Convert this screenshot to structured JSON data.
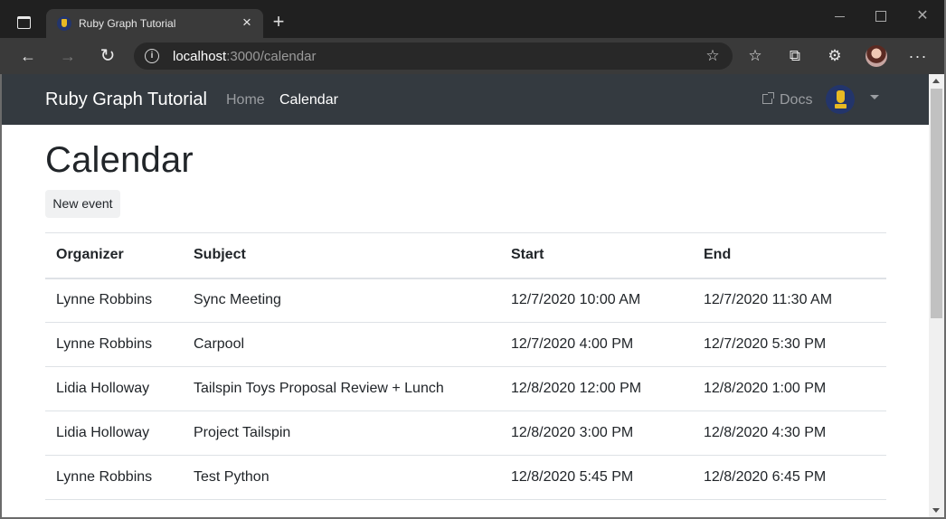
{
  "browser": {
    "tab_title": "Ruby Graph Tutorial",
    "tab_close": "×",
    "new_tab": "+",
    "url_host": "localhost",
    "url_rest": ":3000/calendar",
    "icons": {
      "back": "←",
      "forward": "→",
      "reload": "↻",
      "info": "i",
      "add_favorite": "☆",
      "favorites": "☆",
      "collections": "⧉",
      "extensions": "⚙",
      "more": "···",
      "minimize": "",
      "maximize": "",
      "close": "✕"
    }
  },
  "navbar": {
    "brand": "Ruby Graph Tutorial",
    "links": {
      "home": "Home",
      "calendar": "Calendar"
    },
    "docs": "Docs"
  },
  "main": {
    "title": "Calendar",
    "new_event_label": "New event",
    "table": {
      "headers": {
        "organizer": "Organizer",
        "subject": "Subject",
        "start": "Start",
        "end": "End"
      },
      "rows": [
        {
          "organizer": "Lynne Robbins",
          "subject": "Sync Meeting",
          "start": "12/7/2020 10:00 AM",
          "end": "12/7/2020 11:30 AM"
        },
        {
          "organizer": "Lynne Robbins",
          "subject": "Carpool",
          "start": "12/7/2020 4:00 PM",
          "end": "12/7/2020 5:30 PM"
        },
        {
          "organizer": "Lidia Holloway",
          "subject": "Tailspin Toys Proposal Review + Lunch",
          "start": "12/8/2020 12:00 PM",
          "end": "12/8/2020 1:00 PM"
        },
        {
          "organizer": "Lidia Holloway",
          "subject": "Project Tailspin",
          "start": "12/8/2020 3:00 PM",
          "end": "12/8/2020 4:30 PM"
        },
        {
          "organizer": "Lynne Robbins",
          "subject": "Test Python",
          "start": "12/8/2020 5:45 PM",
          "end": "12/8/2020 6:45 PM"
        }
      ]
    }
  },
  "colors": {
    "navbar_bg": "#343a40",
    "chrome_dark": "#202020",
    "chrome_toolbar": "#3a3a3a",
    "text": "#212529"
  }
}
